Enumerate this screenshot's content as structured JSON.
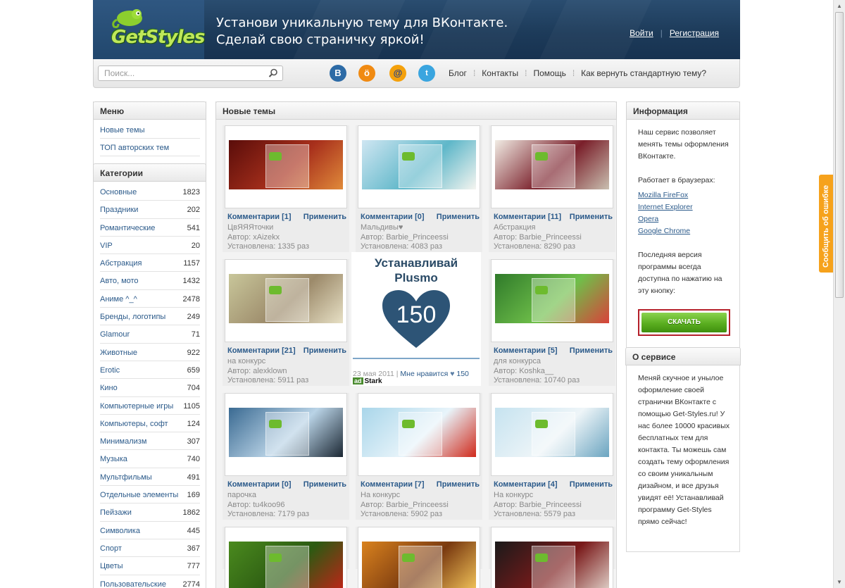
{
  "header": {
    "logo": "GetStyles",
    "tagline_line1": "Установи уникальную тему для ВКонтакте.",
    "tagline_line2": "Сделай свою страничку яркой!",
    "login": "Войти",
    "register": "Регистрация"
  },
  "toolbar": {
    "search_placeholder": "Поиск...",
    "social": [
      "vk-icon",
      "odnoklassniki-icon",
      "mailru-icon",
      "twitter-icon"
    ],
    "nav": [
      "Блог",
      "Контакты",
      "Помощь",
      "Как вернуть стандартную тему?"
    ]
  },
  "menu": {
    "title": "Меню",
    "items": [
      "Новые темы",
      "ТОП авторских тем"
    ]
  },
  "categories": {
    "title": "Категории",
    "items": [
      {
        "name": "Основные",
        "count": "1823"
      },
      {
        "name": "Праздники",
        "count": "202"
      },
      {
        "name": "Романтические",
        "count": "541"
      },
      {
        "name": "VIP",
        "count": "20"
      },
      {
        "name": "Абстракция",
        "count": "1157"
      },
      {
        "name": "Авто, мото",
        "count": "1432"
      },
      {
        "name": "Аниме ^_^",
        "count": "2478"
      },
      {
        "name": "Бренды, логотипы",
        "count": "249"
      },
      {
        "name": "Glamour",
        "count": "71"
      },
      {
        "name": "Животные",
        "count": "922"
      },
      {
        "name": "Erotic",
        "count": "659"
      },
      {
        "name": "Кино",
        "count": "704"
      },
      {
        "name": "Компьютерные игры",
        "count": "1105"
      },
      {
        "name": "Компьютеры, софт",
        "count": "124"
      },
      {
        "name": "Минимализм",
        "count": "307"
      },
      {
        "name": "Музыка",
        "count": "740"
      },
      {
        "name": "Мультфильмы",
        "count": "491"
      },
      {
        "name": "Отдельные элементы",
        "count": "169"
      },
      {
        "name": "Пейзажи",
        "count": "1862"
      },
      {
        "name": "Символика",
        "count": "445"
      },
      {
        "name": "Спорт",
        "count": "367"
      },
      {
        "name": "Цветы",
        "count": "777"
      },
      {
        "name": "Пользовательские",
        "count": "2774"
      }
    ]
  },
  "main": {
    "title": "Новые темы",
    "apply_label": "Применить",
    "themes": [
      {
        "comments": "Комментарии [1]",
        "name": "ЦвЯЯЯточки",
        "author": "Автор: xAizekx",
        "installed": "Установлена: 1335 раз",
        "palette": [
          "#5a0d0a",
          "#a8301c",
          "#e08a3a"
        ]
      },
      {
        "comments": "Комментарии [0]",
        "name": "Мальдивы♥",
        "author": "Автор: Barbie_Princeessi",
        "installed": "Установлена: 4083 раз",
        "palette": [
          "#cfe6f2",
          "#5fb7c9",
          "#f5f5f0"
        ]
      },
      {
        "comments": "Комментарии [11]",
        "name": "Абстракция",
        "author": "Автор: Barbie_Princeessi",
        "installed": "Установлена: 8290 раз",
        "palette": [
          "#f1ece4",
          "#7a1f2a",
          "#c9bfb0"
        ]
      },
      {
        "comments": "Комментарии [21]",
        "name": "на конкурс",
        "author": "Автор: alexklown",
        "installed": "Установлена: 5911 раз",
        "palette": [
          "#c8c69a",
          "#9c8a6a",
          "#e7e0c5"
        ]
      },
      {
        "comments": "Комментарии [5]",
        "name": "для конкурса",
        "author": "Автор: Koshka__",
        "installed": "Установлена: 10740 раз",
        "palette": [
          "#2f7a2a",
          "#6fbf4a",
          "#d9413a"
        ]
      },
      {
        "comments": "Комментарии [0]",
        "name": "парочка",
        "author": "Автор: tu4koo96",
        "installed": "Установлена: 7179 раз",
        "palette": [
          "#3a6a92",
          "#b9d3e6",
          "#1b2733"
        ]
      },
      {
        "comments": "Комментарии [7]",
        "name": "На конкурс",
        "author": "Автор: Barbie_Princeessi",
        "installed": "Установлена: 5902 раз",
        "palette": [
          "#a9d6ea",
          "#e8f4fa",
          "#d02a1c"
        ]
      },
      {
        "comments": "Комментарии [4]",
        "name": "На конкурс",
        "author": "Автор: Barbie_Princeessi",
        "installed": "Установлена: 5579 раз",
        "palette": [
          "#c6e3f0",
          "#eef5f8",
          "#6aa4c0"
        ]
      },
      {
        "comments": "",
        "name": "",
        "author": "",
        "installed": "",
        "palette": [
          "#4a8a1e",
          "#2c5a12",
          "#c02418"
        ]
      },
      {
        "comments": "",
        "name": "",
        "author": "",
        "installed": "",
        "palette": [
          "#d9821e",
          "#7a3a10",
          "#f2c45a"
        ]
      },
      {
        "comments": "",
        "name": "",
        "author": "",
        "installed": "",
        "palette": [
          "#1a1a1a",
          "#7a1a1a",
          "#e0d0c8"
        ]
      }
    ],
    "ad": {
      "title_line1": "Устанавливай",
      "title_line2": "Plusmo",
      "heart_number": "150",
      "date": "23 мая 2011",
      "likes_label": "Мне нравится",
      "likes_count": "150",
      "brand": "Stark",
      "brand_badge": "ad"
    }
  },
  "sidebar": {
    "info_title": "Информация",
    "info_text": "Наш сервис позволяет менять темы оформления ВКонтакте.",
    "browsers_label": "Работает в браузерах:",
    "browsers": [
      "Mozilla FireFox",
      "Internet Explorer",
      "Opera",
      "Google Chrome"
    ],
    "version_text": "Последняя версия программы всегда доступна по нажатию на эту кнопку:",
    "download_label": "СКАЧАТЬ",
    "about_title": "О сервисе",
    "about_text": "Меняй скучное и унылое оформление своей странички ВКонтакте с помощью Get-Styles.ru! У нас более 10000 красивых бесплатных тем для контакта. Ты можешь сам создать тему оформления со своим уникальным дизайном, и все друзья увидят её! Устанавливай программу Get-Styles прямо сейчас!"
  },
  "feedback_label": "Сообщить об ошибке",
  "colors": {
    "header_bg": "#1d3b5a",
    "link": "#2b5a8a",
    "download_green": "#5aae20",
    "feedback_orange": "#f6a21c"
  }
}
